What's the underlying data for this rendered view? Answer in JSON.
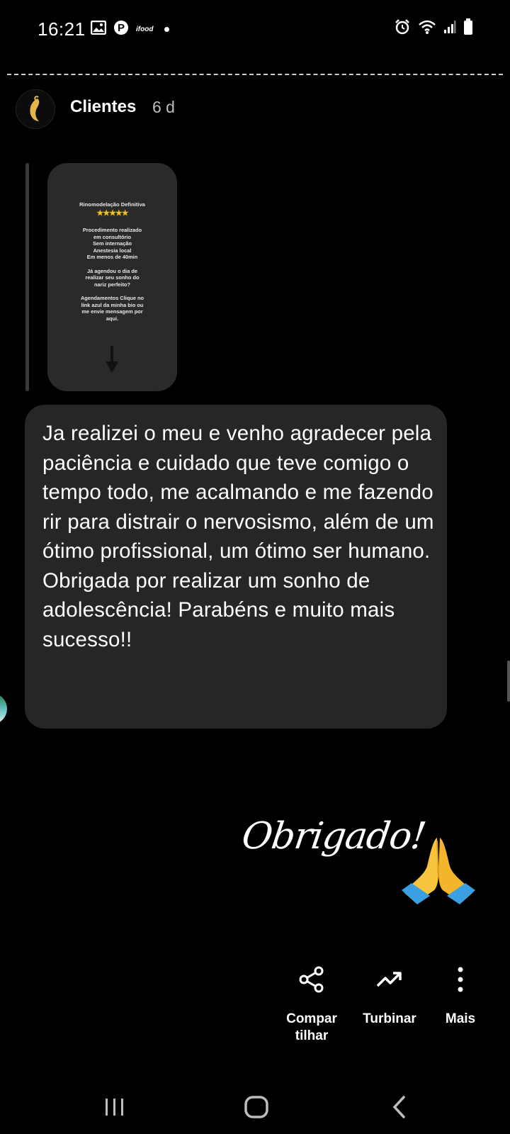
{
  "status_bar": {
    "time": "16:21",
    "ifood_label": "ifood",
    "left_icons": [
      "gallery-icon",
      "pinterest-icon",
      "ifood-icon",
      "notification-dot"
    ],
    "right_icons": [
      "alarm-icon",
      "wifi-icon",
      "signal-icon",
      "battery-icon"
    ]
  },
  "story": {
    "account_name": "Clientes",
    "time_ago": "6 d"
  },
  "quoted_post": {
    "title": "Rinomodelação Definitiva",
    "stars": "★★★★★",
    "body": "Procedimento realizado\nem consultório\nSem internação\nAnestesia local\nEm menos de 40min\n\nJá agendou o dia de\nrealizar seu sonho do\nnariz perfeito?\n\nAgendamentos Clique no\nlink azul da minha bio ou\nme envie mensagem por\naqui."
  },
  "message": {
    "text": "Ja realizei o meu e venho agradecer pela paciência e cuidado que teve comigo o tempo todo, me acalmando e me fazendo rir para distrair o nervosismo, além de um ótimo profissional, um ótimo ser humano. Obrigada por realizar um sonho de adolescência! Parabéns e muito mais sucesso!!"
  },
  "sticker": {
    "text": "Obrigado!",
    "emoji_icon": "praying-hands-icon"
  },
  "actions": {
    "share_line1": "Compar",
    "share_line2": "tilhar",
    "boost": "Turbinar",
    "more": "Mais"
  },
  "nav": {
    "icons": [
      "recent-apps-icon",
      "home-icon",
      "back-icon"
    ]
  },
  "colors": {
    "background": "#000000",
    "bubble": "#262626",
    "thumbnail": "#2a2a2a",
    "stars": "#f2c21b",
    "muted_text": "#bdbdbd"
  }
}
